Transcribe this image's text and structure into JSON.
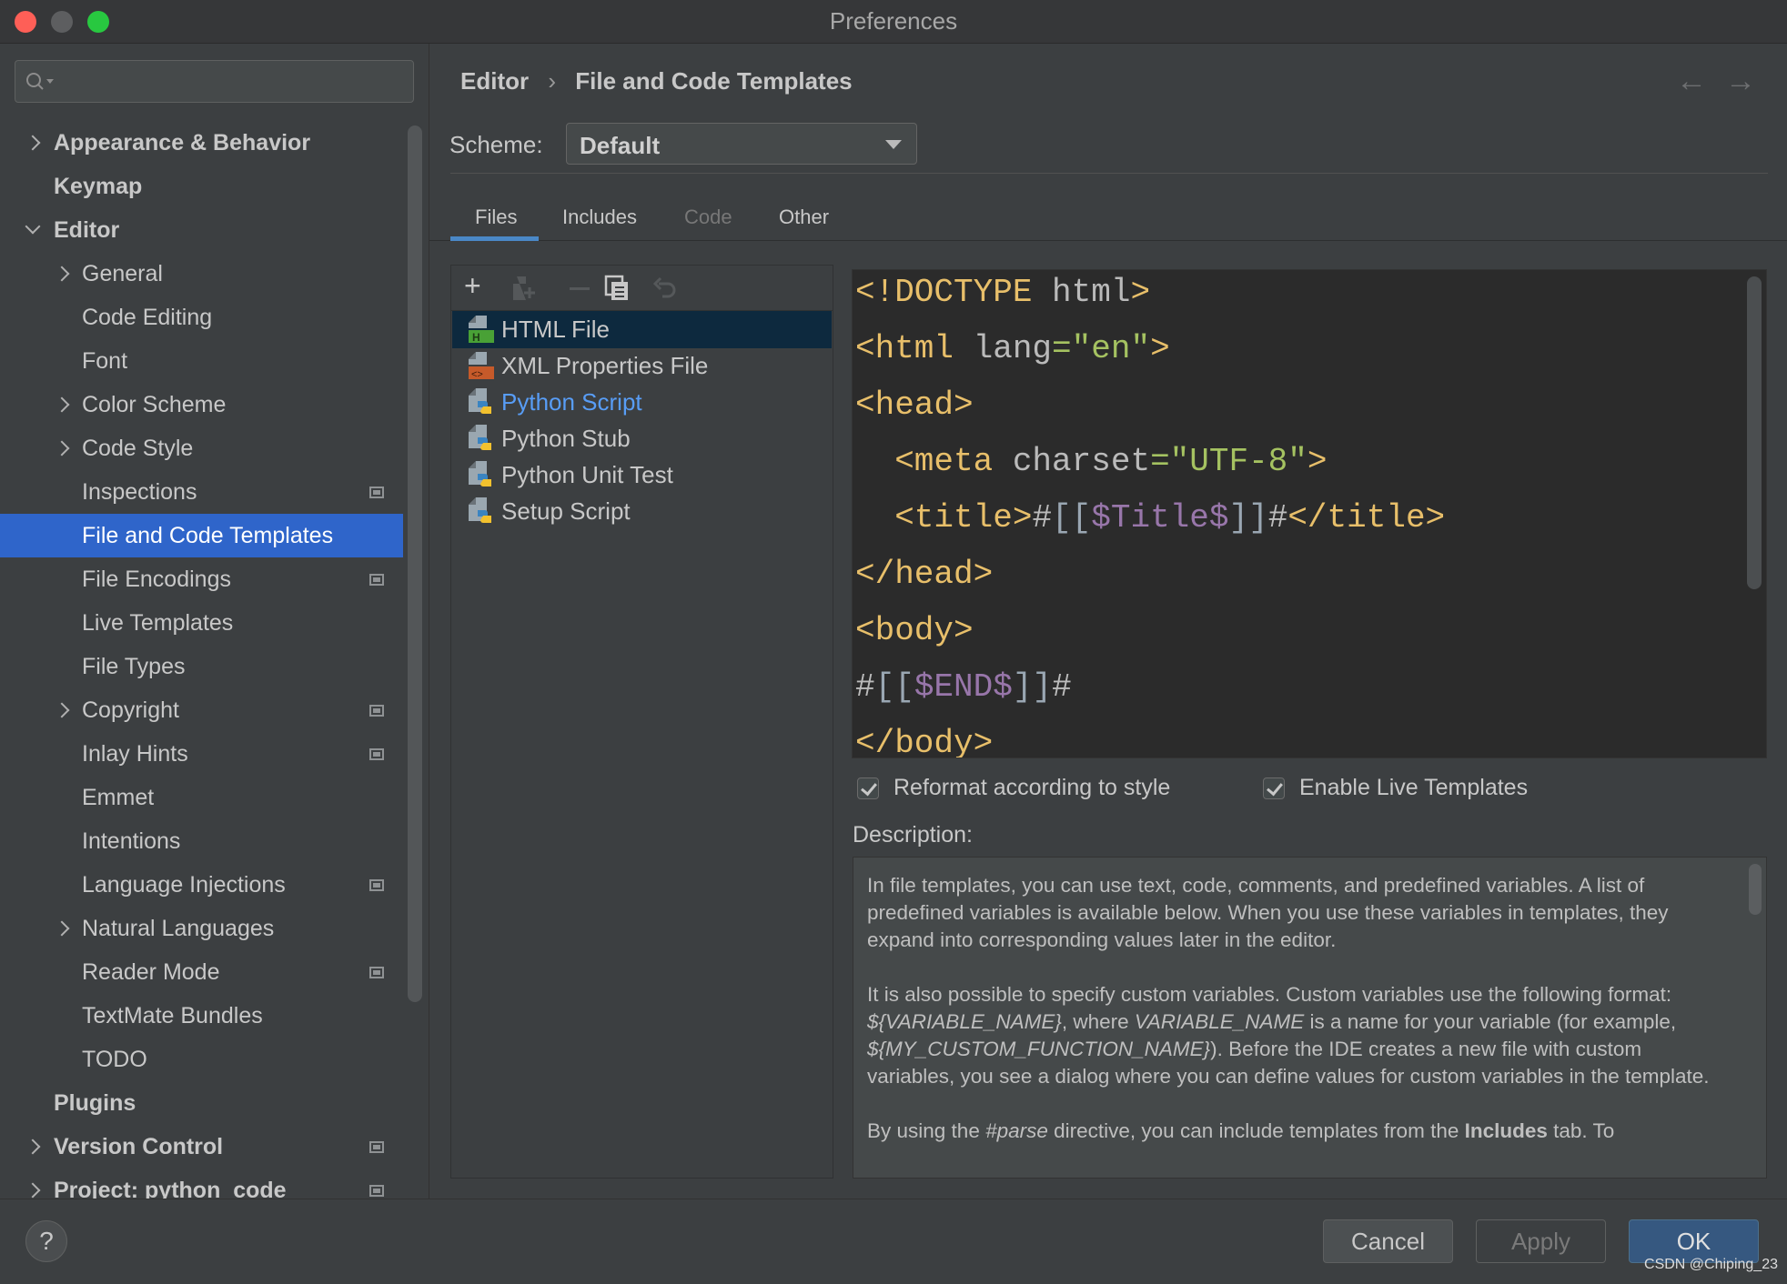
{
  "window": {
    "title": "Preferences"
  },
  "colors": {
    "accent": "#2f65ca",
    "selected_list": "#0d293e",
    "tag": "#e8bf6a",
    "string": "#a5c261",
    "variable": "#9876aa",
    "ok_button": "#365880"
  },
  "search": {
    "placeholder": ""
  },
  "sidebar": {
    "items": [
      {
        "label": "Appearance & Behavior",
        "level": 0,
        "chevron": "right"
      },
      {
        "label": "Keymap",
        "level": 0,
        "chevron": ""
      },
      {
        "label": "Editor",
        "level": 0,
        "chevron": "down"
      },
      {
        "label": "General",
        "level": 1,
        "chevron": "right"
      },
      {
        "label": "Code Editing",
        "level": 1,
        "chevron": ""
      },
      {
        "label": "Font",
        "level": 1,
        "chevron": ""
      },
      {
        "label": "Color Scheme",
        "level": 1,
        "chevron": "right"
      },
      {
        "label": "Code Style",
        "level": 1,
        "chevron": "right"
      },
      {
        "label": "Inspections",
        "level": 1,
        "chevron": "",
        "badge": true
      },
      {
        "label": "File and Code Templates",
        "level": 1,
        "chevron": "",
        "selected": true
      },
      {
        "label": "File Encodings",
        "level": 1,
        "chevron": "",
        "badge": true
      },
      {
        "label": "Live Templates",
        "level": 1,
        "chevron": ""
      },
      {
        "label": "File Types",
        "level": 1,
        "chevron": ""
      },
      {
        "label": "Copyright",
        "level": 1,
        "chevron": "right",
        "badge": true
      },
      {
        "label": "Inlay Hints",
        "level": 1,
        "chevron": "",
        "badge": true
      },
      {
        "label": "Emmet",
        "level": 1,
        "chevron": ""
      },
      {
        "label": "Intentions",
        "level": 1,
        "chevron": ""
      },
      {
        "label": "Language Injections",
        "level": 1,
        "chevron": "",
        "badge": true
      },
      {
        "label": "Natural Languages",
        "level": 1,
        "chevron": "right"
      },
      {
        "label": "Reader Mode",
        "level": 1,
        "chevron": "",
        "badge": true
      },
      {
        "label": "TextMate Bundles",
        "level": 1,
        "chevron": ""
      },
      {
        "label": "TODO",
        "level": 1,
        "chevron": ""
      },
      {
        "label": "Plugins",
        "level": 0,
        "chevron": ""
      },
      {
        "label": "Version Control",
        "level": 0,
        "chevron": "right",
        "badge": true
      },
      {
        "label": "Project: python_code",
        "level": 0,
        "chevron": "right",
        "badge": true
      }
    ]
  },
  "breadcrumb": {
    "parent": "Editor",
    "separator": "›",
    "current": "File and Code Templates"
  },
  "nav": {
    "back": "←",
    "forward": "→"
  },
  "scheme": {
    "label": "Scheme:",
    "value": "Default"
  },
  "tabs": [
    {
      "label": "Files",
      "active": true
    },
    {
      "label": "Includes"
    },
    {
      "label": "Code",
      "disabled": true
    },
    {
      "label": "Other"
    }
  ],
  "toolbar": {
    "add": "+",
    "remove": "−",
    "copy_icon": "copy-icon",
    "reset_icon": "undo-icon"
  },
  "templates": [
    {
      "label": "HTML File",
      "icon": "html",
      "selected": true
    },
    {
      "label": "XML Properties File",
      "icon": "xml"
    },
    {
      "label": "Python Script",
      "icon": "python",
      "highlight": true
    },
    {
      "label": "Python Stub",
      "icon": "python"
    },
    {
      "label": "Python Unit Test",
      "icon": "python"
    },
    {
      "label": "Setup Script",
      "icon": "python"
    }
  ],
  "code": [
    [
      [
        "<!DOCTYPE ",
        "tag"
      ],
      [
        "html",
        "attr"
      ],
      [
        ">",
        "tag"
      ]
    ],
    [
      [
        "<html ",
        "tag"
      ],
      [
        "lang",
        "attr"
      ],
      [
        "=\"en\"",
        "val"
      ],
      [
        ">",
        "tag"
      ]
    ],
    [
      [
        "<head>",
        "tag"
      ]
    ],
    [
      [
        "  <meta ",
        "tag"
      ],
      [
        "charset",
        "attr"
      ],
      [
        "=\"UTF-8\"",
        "val"
      ],
      [
        ">",
        "tag"
      ]
    ],
    [
      [
        "  <title>",
        "tag"
      ],
      [
        "#",
        "plain"
      ],
      [
        "[[",
        "br"
      ],
      [
        "$Title$",
        "var"
      ],
      [
        "]]",
        "br"
      ],
      [
        "#",
        "plain"
      ],
      [
        "</title>",
        "tag"
      ]
    ],
    [
      [
        "</head>",
        "tag"
      ]
    ],
    [
      [
        "<body>",
        "tag"
      ]
    ],
    [
      [
        "#",
        "plain"
      ],
      [
        "[[",
        "br"
      ],
      [
        "$END$",
        "var"
      ],
      [
        "]]",
        "br"
      ],
      [
        "#",
        "plain"
      ]
    ],
    [
      [
        "</body>",
        "tag"
      ]
    ]
  ],
  "options": {
    "reformat": {
      "label": "Reformat according to style",
      "checked": true
    },
    "live_templates": {
      "label": "Enable Live Templates",
      "checked": true
    }
  },
  "description": {
    "label": "Description:",
    "paragraphs": [
      [
        [
          "In file templates, you can use text, code, comments, and predefined variables. A list of predefined variables is available below. When you use these variables in templates, they expand into corresponding values later in the editor.",
          ""
        ]
      ],
      [
        [
          "It is also possible to specify custom variables. Custom variables use the following format: ",
          ""
        ],
        [
          "${VARIABLE_NAME}",
          "i"
        ],
        [
          ", where ",
          ""
        ],
        [
          "VARIABLE_NAME",
          "i"
        ],
        [
          " is a name for your variable (for example, ",
          ""
        ],
        [
          "${MY_CUSTOM_FUNCTION_NAME}",
          "i"
        ],
        [
          "). Before the IDE creates a new file with custom variables, you see a dialog where you can define values for custom variables in the template.",
          ""
        ]
      ],
      [
        [
          "By using the ",
          ""
        ],
        [
          "#parse",
          "i"
        ],
        [
          " directive, you can include templates from the ",
          ""
        ],
        [
          "Includes",
          "b"
        ],
        [
          " tab. To",
          ""
        ]
      ]
    ]
  },
  "buttons": {
    "help": "?",
    "cancel": "Cancel",
    "apply": "Apply",
    "ok": "OK"
  },
  "watermark": "CSDN @Chiping_23"
}
